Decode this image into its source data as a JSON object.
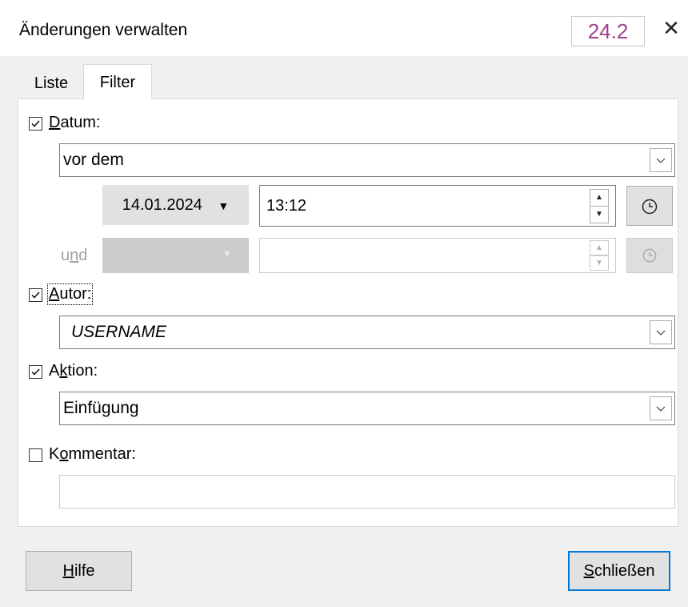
{
  "window": {
    "title": "Änderungen verwalten",
    "version_badge": "24.2",
    "close_glyph": "✕"
  },
  "tabs": [
    {
      "label": "Liste",
      "active": false
    },
    {
      "label": "Filter",
      "active": true
    }
  ],
  "filter": {
    "datum": {
      "checked": true,
      "label_pre": "",
      "label_accel": "D",
      "label_post": "atum:",
      "condition": "vor dem",
      "date": "14.01.2024",
      "date_arrow": "▼",
      "time": "13:12",
      "und_pre": "u",
      "und_accel": "n",
      "und_post": "d",
      "disabled_arrow": "▼"
    },
    "autor": {
      "checked": true,
      "label_pre": "",
      "label_accel": "A",
      "label_post": "utor:",
      "value": "USERNAME"
    },
    "aktion": {
      "checked": true,
      "label_pre": "A",
      "label_accel": "k",
      "label_post": "tion:",
      "value": "Einfügung"
    },
    "kommentar": {
      "checked": false,
      "label_pre": "K",
      "label_accel": "o",
      "label_post": "mmentar:",
      "value": ""
    }
  },
  "icons": {
    "check": "☑",
    "unchecked": "☐",
    "chevron": "﹀",
    "spin_up": "▲",
    "spin_down": "▼"
  },
  "buttons": {
    "help_accel": "H",
    "help_rest": "ilfe",
    "close_accel": "S",
    "close_rest": "chließen"
  },
  "colors": {
    "accent": "#0078d7",
    "version_text": "#a0408a"
  }
}
